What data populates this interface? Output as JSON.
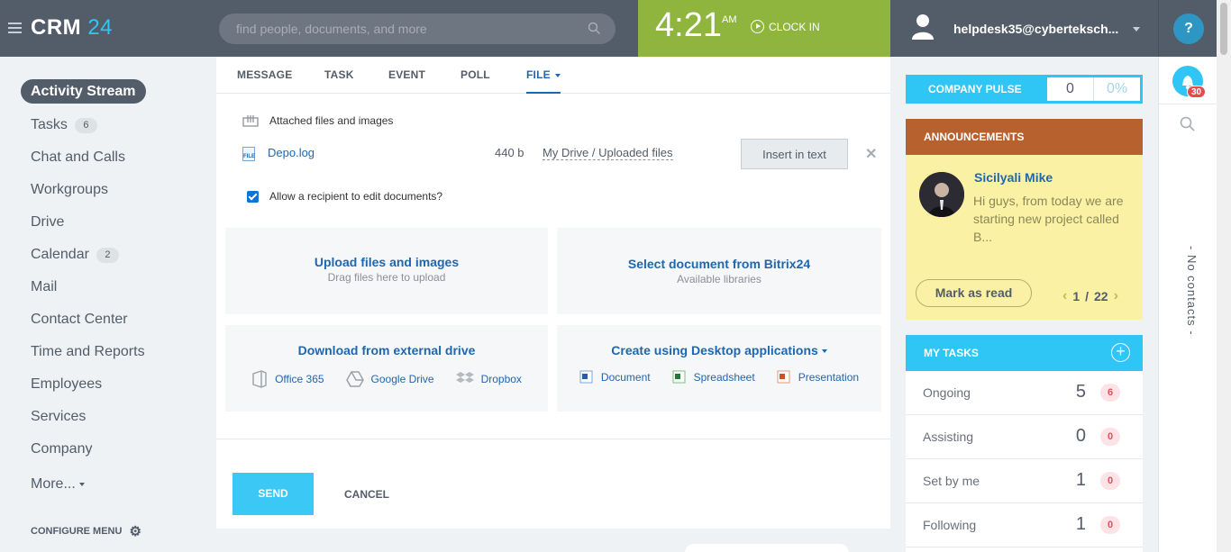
{
  "header": {
    "logo": "CRM",
    "logo_num": "24",
    "search_placeholder": "find people, documents, and more",
    "time": "4:21",
    "ampm": "AM",
    "clock_in": "CLOCK IN",
    "user": "helpdesk35@cyberteksch...",
    "help": "?"
  },
  "sidebar": {
    "active": "Activity Stream",
    "items": [
      {
        "label": "Tasks",
        "badge": "6"
      },
      {
        "label": "Chat and Calls"
      },
      {
        "label": "Workgroups"
      },
      {
        "label": "Drive"
      },
      {
        "label": "Calendar",
        "badge": "2"
      },
      {
        "label": "Mail"
      },
      {
        "label": "Contact Center"
      },
      {
        "label": "Time and Reports"
      },
      {
        "label": "Employees"
      },
      {
        "label": "Services"
      },
      {
        "label": "Company"
      },
      {
        "label": "More..."
      }
    ],
    "configure": "CONFIGURE MENU"
  },
  "composer": {
    "tabs": [
      "MESSAGE",
      "TASK",
      "EVENT",
      "POLL",
      "FILE"
    ],
    "attached_title": "Attached files and images",
    "file": {
      "icon": "FILE",
      "name": "Depo.log",
      "size": "440 b",
      "path": "My Drive / Uploaded files",
      "insert": "Insert in text"
    },
    "allow_edit": "Allow a recipient to edit documents?",
    "upload": {
      "title": "Upload files and images",
      "sub": "Drag files here to upload"
    },
    "select_doc": {
      "title": "Select document from Bitrix24",
      "sub": "Available libraries"
    },
    "external": {
      "title": "Download from external drive",
      "items": [
        "Office 365",
        "Google Drive",
        "Dropbox"
      ]
    },
    "desktop": {
      "title": "Create using Desktop applications",
      "items": [
        "Document",
        "Spreadsheet",
        "Presentation"
      ]
    },
    "send": "SEND",
    "cancel": "CANCEL"
  },
  "pulse": {
    "label": "COMPANY PULSE",
    "value": "0",
    "percent": "0%"
  },
  "announcements": {
    "title": "ANNOUNCEMENTS",
    "author": "Sicilyali Mike",
    "text": "Hi guys, from today we are starting new project called B...",
    "mark_read": "Mark as read",
    "page": "1",
    "total": "22"
  },
  "tasks": {
    "title": "MY TASKS",
    "rows": [
      {
        "label": "Ongoing",
        "count": "5",
        "badge": "6"
      },
      {
        "label": "Assisting",
        "count": "0",
        "badge": "0"
      },
      {
        "label": "Set by me",
        "count": "1",
        "badge": "0"
      },
      {
        "label": "Following",
        "count": "1",
        "badge": "0"
      }
    ]
  },
  "rightbar": {
    "bell_count": "30",
    "no_contacts": "- No contacts -"
  },
  "colors": {
    "header": "#535c69",
    "accent": "#2fc6f6",
    "clock": "#90b53e",
    "announce": "#b7612f",
    "link": "#2067b0"
  }
}
